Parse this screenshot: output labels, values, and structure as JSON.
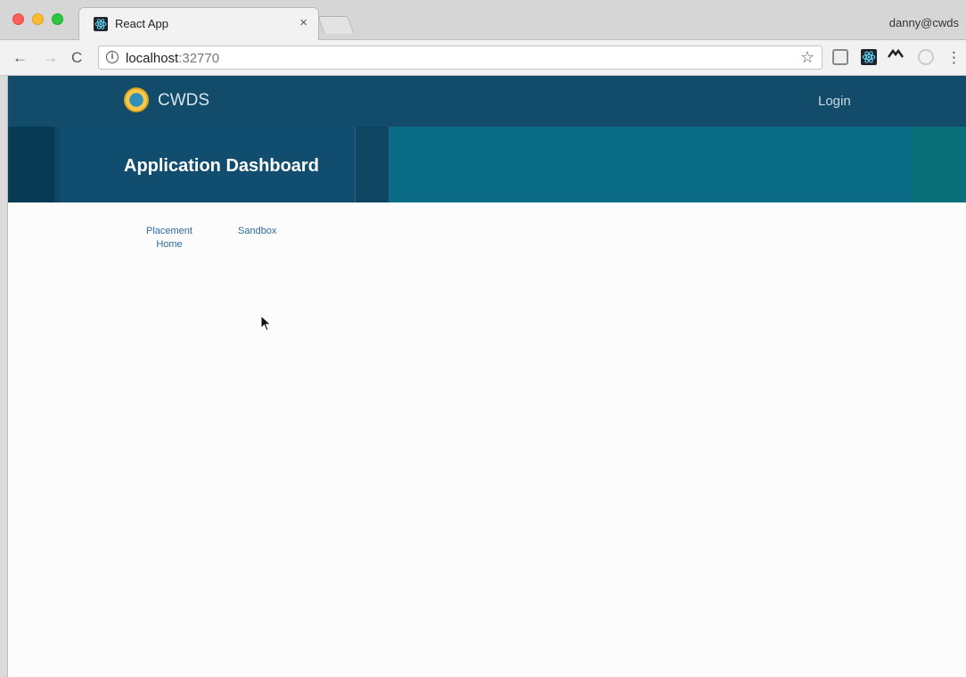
{
  "browser": {
    "tab_title": "React App",
    "tab_close": "×",
    "profile_name": "danny@cwds",
    "url_host": "localhost",
    "url_port": ":32770",
    "info_icon_label": "i",
    "nav_back": "←",
    "nav_forward": "→",
    "nav_reload": "C",
    "bookmark_star": "☆",
    "menu": "⋮",
    "extensions": [
      "square-extension-icon",
      "react-devtools-icon",
      "caret-extension-icon",
      "circle-extension-icon"
    ]
  },
  "app_nav": {
    "brand": "CWDS",
    "login_label": "Login"
  },
  "dashboard": {
    "title": "Application Dashboard"
  },
  "links": {
    "placement_line1": "Placement",
    "placement_line2": "Home",
    "sandbox": "Sandbox"
  },
  "colors": {
    "nav_bg": "#134b6a",
    "header_bg": "#0f4566",
    "header_teal": "#0a6c86",
    "link": "#2b6b9b"
  }
}
